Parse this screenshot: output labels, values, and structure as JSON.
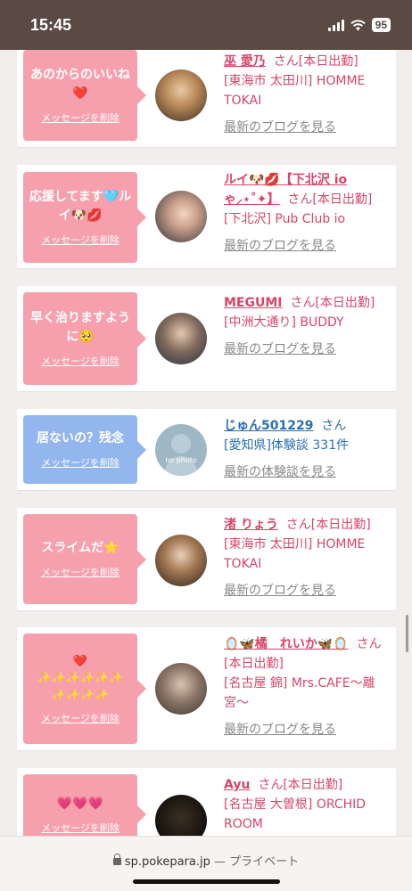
{
  "status": {
    "time": "15:45",
    "battery": "95"
  },
  "url": {
    "domain": "sp.pokepara.jp",
    "suffix": " — プライベート"
  },
  "cards": [
    {
      "message": "あのからのいいね❤️",
      "delete": "メッセージを削除",
      "name": "巫 愛乃",
      "san": "さん",
      "status": "[本日出勤]",
      "shop": "[東海市 太田川] HOMME TOKAI",
      "link": "最新のブログを見る"
    },
    {
      "message": "応援してます🩵ルイ🐶💋",
      "delete": "メッセージを削除",
      "name": "ルイ🐶💋【下北沢 io ゃ⸝⋆˚✦】",
      "san": "さん",
      "status": "[本日出勤]",
      "shop": "[下北沢] Pub Club io",
      "link": "最新のブログを見る"
    },
    {
      "message": "早く治りますように🥺",
      "delete": "メッセージを削除",
      "name": "MEGUMI",
      "san": "さん",
      "status": "[本日出勤]",
      "shop": "[中洲大通り] BUDDY",
      "link": "最新のブログを見る"
    },
    {
      "message": "居ないの？残念",
      "delete": "メッセージを削除",
      "name": "じゅん501229",
      "san": "さん",
      "status": "",
      "shop": "[愛知県]体験談 331件",
      "link": "最新の体験談を見る",
      "avatar_text": "no photo"
    },
    {
      "message": "スライムだ⭐️",
      "delete": "メッセージを削除",
      "name": "渚 りょう",
      "san": "さん",
      "status": "[本日出勤]",
      "shop": "[東海市 太田川] HOMME TOKAI",
      "link": "最新のブログを見る"
    },
    {
      "message": "❤️\n✨✨✨✨✨✨\n✨✨✨✨",
      "delete": "メッセージを削除",
      "name": "🪞🦋橘　れいか🦋🪞",
      "san": "さん",
      "status": "[本日出勤]",
      "shop": "[名古屋 錦] Mrs.CAFE〜離宮〜",
      "link": "最新のブログを見る"
    },
    {
      "message": "💗💗💗",
      "delete": "メッセージを削除",
      "name": "Ayu",
      "san": "さん",
      "status": "[本日出勤]",
      "shop": "[名古屋 大曽根] ORCHID ROOM",
      "link": ""
    }
  ],
  "colors": {
    "pink": "#f7a0ad",
    "blue": "#93b6ee",
    "name_pink": "#d8456a",
    "name_blue": "#2a6fb1"
  }
}
